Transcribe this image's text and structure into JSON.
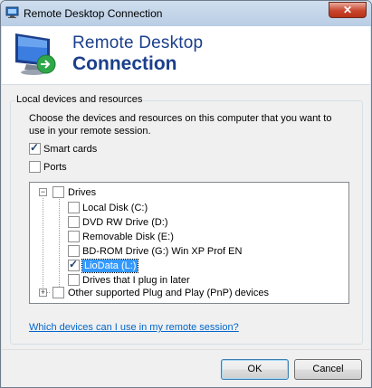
{
  "window": {
    "title": "Remote Desktop Connection",
    "close_glyph": "✕"
  },
  "header": {
    "title_line1": "Remote Desktop",
    "title_line2": "Connection",
    "icon": "remote-desktop-icon"
  },
  "group": {
    "label": "Local devices and resources",
    "description": "Choose the devices and resources on this computer that you want to use in your remote session."
  },
  "options": {
    "smart_cards": {
      "label": "Smart cards",
      "checked": true
    },
    "ports": {
      "label": "Ports",
      "checked": false
    }
  },
  "tree": {
    "drives": {
      "label": "Drives",
      "expand_glyph": "−",
      "checked": false,
      "items": [
        {
          "label": "Local Disk (C:)",
          "checked": false
        },
        {
          "label": "DVD RW Drive (D:)",
          "checked": false
        },
        {
          "label": "Removable Disk (E:)",
          "checked": false
        },
        {
          "label": "BD-ROM Drive (G:) Win XP Prof EN",
          "checked": false
        },
        {
          "label": "LioData (L:)",
          "checked": true,
          "selected": true
        },
        {
          "label": "Drives that I plug in later",
          "checked": false
        }
      ]
    },
    "pnp": {
      "label": "Other supported Plug and Play (PnP) devices",
      "expand_glyph": "+",
      "checked": false
    }
  },
  "help_link": "Which devices can I use in my remote session?",
  "buttons": {
    "ok": "OK",
    "cancel": "Cancel"
  },
  "colors": {
    "accent": "#1b3f8b",
    "link": "#0066cc",
    "selection": "#3399ff"
  }
}
